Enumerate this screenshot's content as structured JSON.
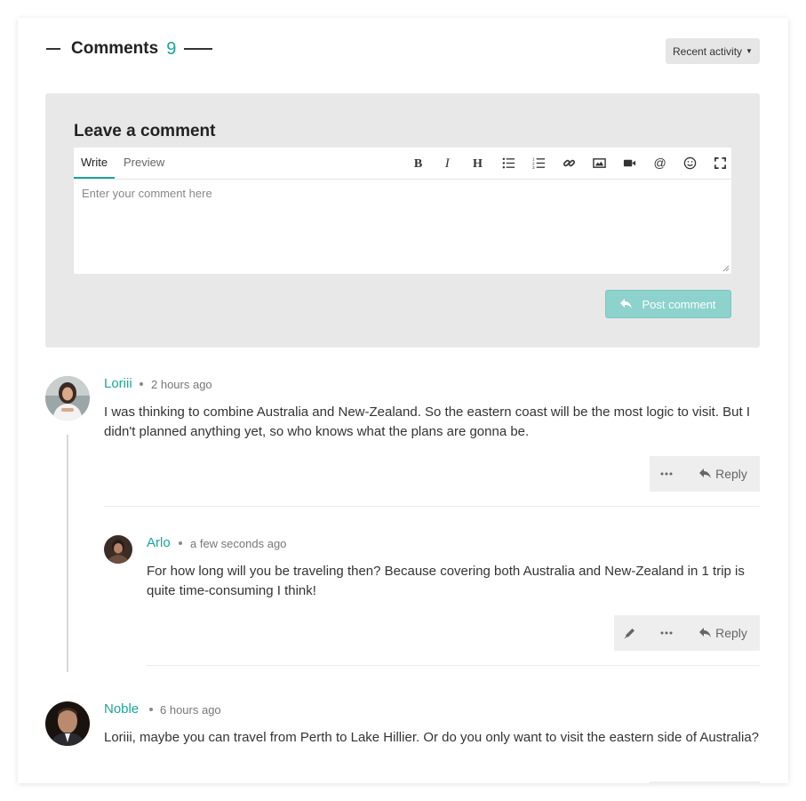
{
  "header": {
    "title": "Comments",
    "count": "9",
    "sort_label": "Recent activity"
  },
  "composer": {
    "title": "Leave a comment",
    "tabs": [
      {
        "label": "Write",
        "active": true
      },
      {
        "label": "Preview",
        "active": false
      }
    ],
    "toolbar": [
      "bold-icon",
      "italic-icon",
      "heading-icon",
      "bulleted-list-icon",
      "numbered-list-icon",
      "link-icon",
      "image-icon",
      "video-icon",
      "mention-icon",
      "emoji-icon",
      "fullscreen-icon"
    ],
    "placeholder": "Enter your comment here",
    "post_label": "Post comment"
  },
  "comments": [
    {
      "author": "Loriii",
      "time": "2 hours ago",
      "text": "I was thinking to combine Australia and New-Zealand. So the eastern coast will be the most logic to visit. But I didn't planned anything yet, so who knows what the plans are gonna be.",
      "reply_label": "Reply",
      "replies": [
        {
          "author": "Arlo",
          "time": "a few seconds ago",
          "text": "For how long will you be traveling then? Because covering both Australia and New-Zealand in 1 trip is quite time-consuming I think!",
          "reply_label": "Reply"
        }
      ]
    },
    {
      "author": "Noble",
      "time": "6 hours ago",
      "text": "Loriii, maybe you can travel from Perth to Lake Hillier. Or do you only want to visit the eastern side of Australia?"
    }
  ],
  "colors": {
    "accent": "#1aa59a",
    "button_disabled": "#8dd2cc",
    "panel": "#e8e8e8"
  }
}
